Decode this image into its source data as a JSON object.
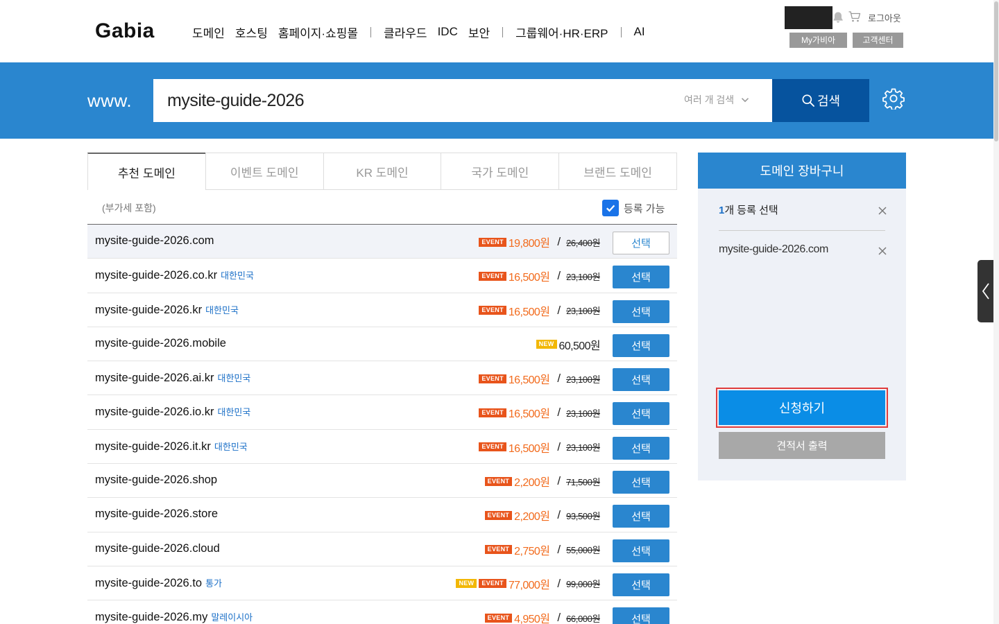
{
  "header": {
    "logo": "Gabia",
    "nav": [
      "도메인",
      "호스팅",
      "홈페이지·쇼핑몰",
      "클라우드",
      "IDC",
      "보안",
      "그룹웨어·HR·ERP",
      "AI"
    ],
    "logout": "로그아웃",
    "mygabia": "My가비아",
    "customer_center": "고객센터"
  },
  "search": {
    "prefix": "www.",
    "query": "mysite-guide-2026",
    "multi_label": "여러 개 검색",
    "button_label": "검색"
  },
  "tabs": [
    "추천 도메인",
    "이벤트 도메인",
    "KR 도메인",
    "국가 도메인",
    "브랜드 도메인"
  ],
  "filters": {
    "vat_note": "(부가세 포함)",
    "available_label": "등록 가능",
    "available_checked": true
  },
  "badges": {
    "event": "EVENT",
    "new": "NEW"
  },
  "results": [
    {
      "domain": "mysite-guide-2026.com",
      "tag": "",
      "badges": [
        "event"
      ],
      "price": "19,800원",
      "original": "26,400원",
      "button": "선택",
      "selected": true
    },
    {
      "domain": "mysite-guide-2026.co.kr",
      "tag": "대한민국",
      "badges": [
        "event"
      ],
      "price": "16,500원",
      "original": "23,100원",
      "button": "선택",
      "selected": false
    },
    {
      "domain": "mysite-guide-2026.kr",
      "tag": "대한민국",
      "badges": [
        "event"
      ],
      "price": "16,500원",
      "original": "23,100원",
      "button": "선택",
      "selected": false
    },
    {
      "domain": "mysite-guide-2026.mobile",
      "tag": "",
      "badges": [
        "new"
      ],
      "price": "60,500원",
      "original": "",
      "button": "선택",
      "selected": false
    },
    {
      "domain": "mysite-guide-2026.ai.kr",
      "tag": "대한민국",
      "badges": [
        "event"
      ],
      "price": "16,500원",
      "original": "23,100원",
      "button": "선택",
      "selected": false
    },
    {
      "domain": "mysite-guide-2026.io.kr",
      "tag": "대한민국",
      "badges": [
        "event"
      ],
      "price": "16,500원",
      "original": "23,100원",
      "button": "선택",
      "selected": false
    },
    {
      "domain": "mysite-guide-2026.it.kr",
      "tag": "대한민국",
      "badges": [
        "event"
      ],
      "price": "16,500원",
      "original": "23,100원",
      "button": "선택",
      "selected": false
    },
    {
      "domain": "mysite-guide-2026.shop",
      "tag": "",
      "badges": [
        "event"
      ],
      "price": "2,200원",
      "original": "71,500원",
      "button": "선택",
      "selected": false
    },
    {
      "domain": "mysite-guide-2026.store",
      "tag": "",
      "badges": [
        "event"
      ],
      "price": "2,200원",
      "original": "93,500원",
      "button": "선택",
      "selected": false
    },
    {
      "domain": "mysite-guide-2026.cloud",
      "tag": "",
      "badges": [
        "event"
      ],
      "price": "2,750원",
      "original": "55,000원",
      "button": "선택",
      "selected": false
    },
    {
      "domain": "mysite-guide-2026.to",
      "tag": "통가",
      "badges": [
        "new",
        "event"
      ],
      "price": "77,000원",
      "original": "99,000원",
      "button": "선택",
      "selected": false
    },
    {
      "domain": "mysite-guide-2026.my",
      "tag": "말레이시아",
      "badges": [
        "event"
      ],
      "price": "4,950원",
      "original": "66,000원",
      "button": "선택",
      "selected": false
    }
  ],
  "cart": {
    "title": "도메인 장바구니",
    "count": "1",
    "count_suffix": "개 등록 선택",
    "items": [
      "mysite-guide-2026.com"
    ],
    "apply_button": "신청하기",
    "quote_button": "견적서 출력"
  },
  "colors": {
    "brand_blue": "#2a86cf",
    "search_button": "#06539e",
    "event_badge": "#e8541b",
    "new_badge": "#f2b705",
    "price_orange": "#f26b1d",
    "apply_blue": "#0a8de6",
    "highlight_red": "#e03b3b"
  },
  "icons": {
    "bell": "bell-icon",
    "cart": "cart-icon",
    "search": "search-icon",
    "settings": "gear-icon",
    "dropdown": "chevron-down-icon",
    "remove": "close-icon",
    "panel_toggle": "chevron-left-icon",
    "checkbox": "check-icon"
  }
}
